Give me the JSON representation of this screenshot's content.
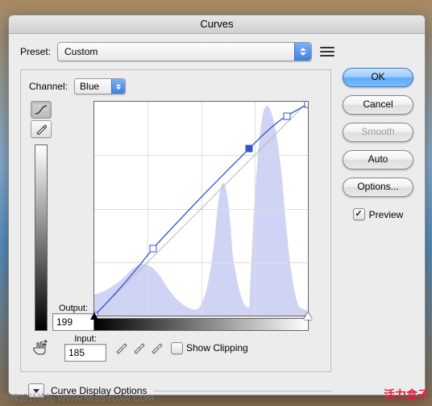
{
  "title": "Curves",
  "preset": {
    "label": "Preset:",
    "value": "Custom"
  },
  "channel": {
    "label": "Channel:",
    "value": "Blue"
  },
  "output": {
    "label": "Output:",
    "value": "199"
  },
  "input": {
    "label": "Input:",
    "value": "185"
  },
  "show_clipping": {
    "label": "Show Clipping",
    "checked": false
  },
  "disclosure": {
    "label": "Curve Display Options"
  },
  "buttons": {
    "ok": "OK",
    "cancel": "Cancel",
    "smooth": "Smooth",
    "auto": "Auto",
    "options": "Options..."
  },
  "preview": {
    "label": "Preview",
    "checked": true
  },
  "chart_data": {
    "type": "line",
    "title": "",
    "xlabel": "Input",
    "ylabel": "Output",
    "xlim": [
      0,
      255
    ],
    "ylim": [
      0,
      255
    ],
    "grid": true,
    "series": [
      {
        "name": "curve",
        "x": [
          0,
          70,
          185,
          230,
          255
        ],
        "y": [
          0,
          80,
          199,
          238,
          252
        ]
      },
      {
        "name": "diagonal",
        "x": [
          0,
          255
        ],
        "y": [
          0,
          255
        ]
      }
    ],
    "histogram_channel": "Blue"
  },
  "watermark_left": "思缘设计论坛  WWW.MISSYUAN.COM",
  "watermark_right": "活力盒子"
}
